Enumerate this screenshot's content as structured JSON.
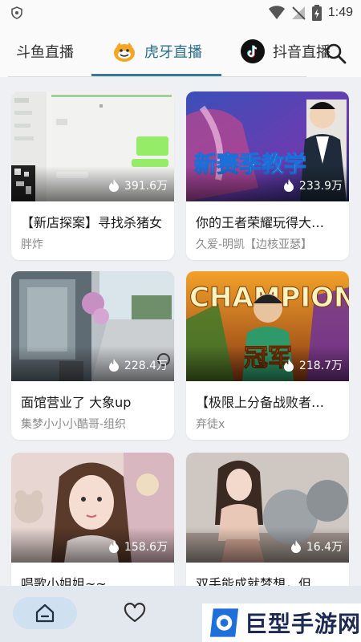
{
  "status_bar": {
    "time": "1:49"
  },
  "tabs": [
    {
      "label": "斗鱼直播"
    },
    {
      "label": "虎牙直播"
    },
    {
      "label": "抖音直播"
    }
  ],
  "active_tab": "虎牙直播",
  "accent_color": "#3b7a93",
  "cards": [
    {
      "title": "【新店探案】寻找杀猪女",
      "anchor": "胖炸",
      "views": "391.6万"
    },
    {
      "title": "你的王者荣耀玩得大…",
      "anchor": "久爱-明凯【边核亚瑟】",
      "views": "233.9万",
      "thumb_text": "新赛季教学"
    },
    {
      "title": "面馆营业了 大象up",
      "anchor": "集梦小小小酷哥-组织",
      "views": "228.4万"
    },
    {
      "title": "【极限上分备战败者…",
      "anchor": "弃徒x",
      "views": "218.7万",
      "thumb_text": "CHAMPION",
      "thumb_text2": "冠军"
    },
    {
      "title": "唱歌小姐姐~~",
      "anchor": "",
      "views": "158.6万"
    },
    {
      "title": "双手能成就梦想，但…",
      "anchor": "",
      "views": "16.4万"
    }
  ],
  "bottom_nav": [
    {
      "icon": "home-icon"
    },
    {
      "icon": "heart-icon"
    }
  ],
  "watermark": {
    "text": "巨型手游网"
  }
}
